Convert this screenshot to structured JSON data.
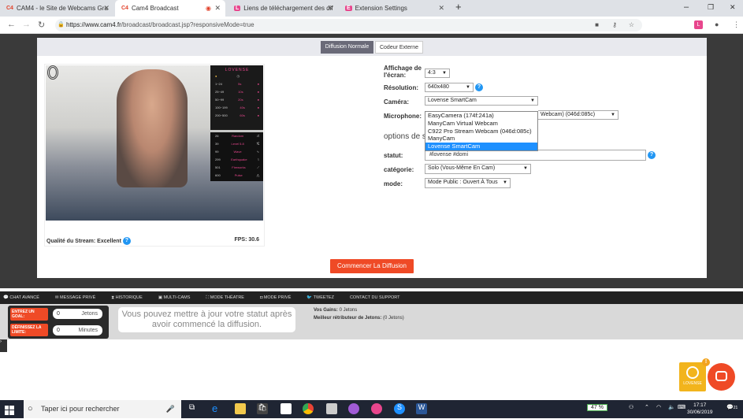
{
  "browser": {
    "tabs": [
      {
        "favicon": "C4",
        "title": "CAM4 - le Site de Webcams Gra"
      },
      {
        "favicon": "C4",
        "title": "Cam4 Broadcast"
      },
      {
        "favicon": "L",
        "title": "Liens de téléchargement des dif"
      },
      {
        "favicon": "E",
        "title": "Extension Settings"
      }
    ],
    "new_tab": "+",
    "minimize": "–",
    "restore": "❐",
    "close": "✕",
    "url_host": "https://www.cam4.fr",
    "url_path": "/broadcast/broadcast.jsp?responsiveMode=true"
  },
  "modes": {
    "normal": "Diffusion Normale",
    "external": "Codeur Externe"
  },
  "stream": {
    "quality_label": "Qualité du Stream: Excellent",
    "fps": "FPS: 30.6",
    "lovense_title": "LOVENSE",
    "lovense_levels": [
      {
        "range": "1~24",
        "sec": "5s"
      },
      {
        "range": "25~49",
        "sec": "10s"
      },
      {
        "range": "50~99",
        "sec": "20s"
      },
      {
        "range": "100~199",
        "sec": "40s"
      },
      {
        "range": "200~500",
        "sec": "60s"
      }
    ],
    "lovense_specials": [
      {
        "tokens": "26",
        "label": "Random"
      },
      {
        "tokens": "39",
        "label": "Level 5.8"
      },
      {
        "tokens": "99",
        "label": "Wave"
      },
      {
        "tokens": "299",
        "label": "Earthquake"
      },
      {
        "tokens": "501",
        "label": "Fireworks"
      },
      {
        "tokens": "600",
        "label": "Pulse"
      }
    ]
  },
  "settings": {
    "display_label": "Affichage de l'écran:",
    "display_value": "4:3",
    "resolution_label": "Résolution:",
    "resolution_value": "640x480",
    "camera_label": "Caméra:",
    "camera_value": "Lovense SmartCam",
    "camera_options": [
      "EasyCamera (174f:241a)",
      "ManyCam Virtual Webcam",
      "C922 Pro Stream Webcam (046d:085c)",
      "ManyCam",
      "Lovense SmartCam"
    ],
    "microphone_label": "Microphone:",
    "microphone_value": "Webcam) (046d:085c)",
    "options_title": "options de s",
    "status_label": "statut:",
    "status_value": "#lovense #domi",
    "category_label": "catégorie:",
    "category_value": "Solo (Vous-Même En Cam)",
    "mode_label": "mode:",
    "mode_value": "Mode Public : Ouvert À Tous",
    "start_button": "Commencer La Diffusion"
  },
  "toolbar": {
    "items": [
      "CHAT AVANCÉ",
      "MESSAGE PRIVÉ",
      "HISTORIQUE",
      "MULTI-CAMS",
      "MODE THÉATRE",
      "MODE PRIVÉ",
      "TWEETEZ",
      "CONTACT DU SUPPORT"
    ]
  },
  "goal": {
    "goal_label": "ENTREZ UN GOAL:",
    "goal_value": "0",
    "goal_unit": "Jetons",
    "limit_label": "DÉFINISSEZ LA LIMITE:",
    "limit_value": "0",
    "limit_unit": "Minutes",
    "notice": "Vous pouvez mettre à jour votre statut après avoir commencé la diffusion.",
    "gains_label": "Vos Gains:",
    "gains_value": "0 Jetons",
    "best_label": "Meilleur rétributeur de Jetons:",
    "best_value": "(0 Jetons)"
  },
  "lovense_badge": {
    "label": "LOVENSE",
    "notification": "!"
  },
  "taskbar": {
    "search_placeholder": "Taper ici pour rechercher",
    "battery": "47 %",
    "time": "17:17",
    "date": "30/06/2019",
    "notifications": "21"
  },
  "colors": {
    "accent": "#ef4a26",
    "lovense_pink": "#e8468d",
    "help_blue": "#2196f3",
    "highlight": "#1e90ff"
  }
}
